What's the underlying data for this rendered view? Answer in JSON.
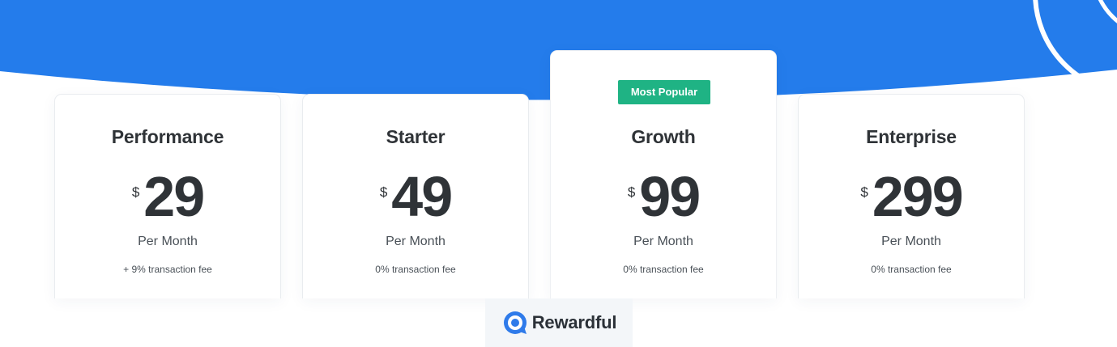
{
  "theme": {
    "hero_blue": "#247ceb",
    "badge_green": "#1fb384",
    "text_dark": "#2f3337",
    "brand_bg": "#f3f6f9"
  },
  "plans": [
    {
      "name": "Performance",
      "currency": "$",
      "amount": "29",
      "period": "Per Month",
      "fee": "+ 9% transaction fee"
    },
    {
      "name": "Starter",
      "currency": "$",
      "amount": "49",
      "period": "Per Month",
      "fee": "0% transaction fee"
    },
    {
      "name": "Growth",
      "badge": "Most Popular",
      "currency": "$",
      "amount": "99",
      "period": "Per Month",
      "fee": "0% transaction fee"
    },
    {
      "name": "Enterprise",
      "currency": "$",
      "amount": "299",
      "period": "Per Month",
      "fee": "0% transaction fee"
    }
  ],
  "brand": {
    "name": "Rewardful",
    "icon": "rewardful-logo-icon"
  }
}
